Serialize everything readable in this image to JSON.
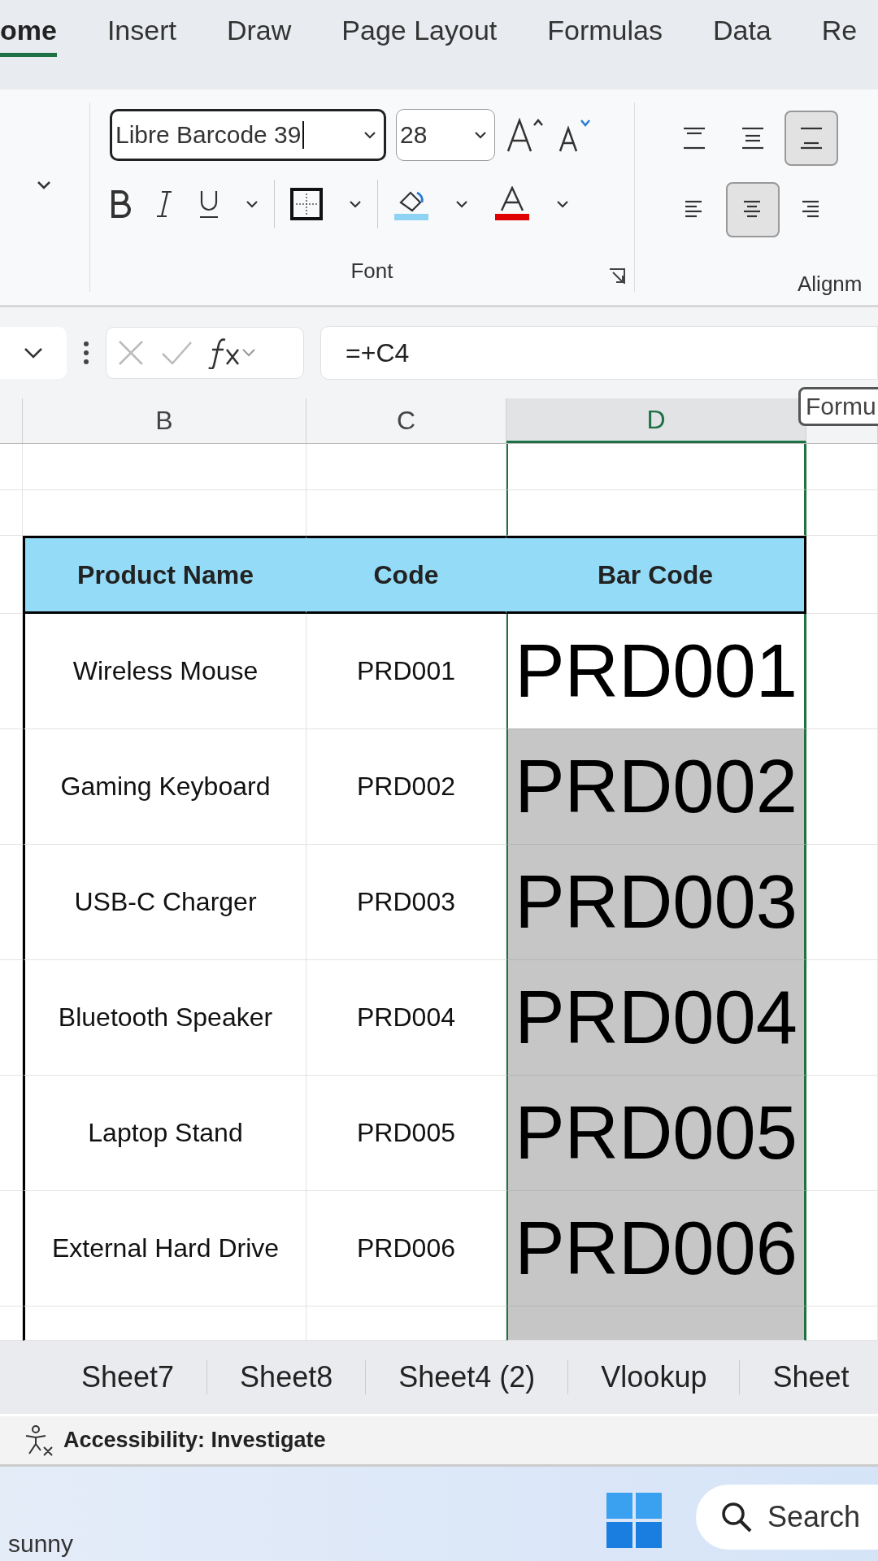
{
  "ribbon_tabs": [
    {
      "label": "ome",
      "selected": true
    },
    {
      "label": "Insert",
      "selected": false
    },
    {
      "label": "Draw",
      "selected": false
    },
    {
      "label": "Page Layout",
      "selected": false
    },
    {
      "label": "Formulas",
      "selected": false
    },
    {
      "label": "Data",
      "selected": false
    },
    {
      "label": "Re",
      "selected": false
    }
  ],
  "font_group": {
    "font_name": "Libre Barcode 39",
    "font_size": "28",
    "label": "Font"
  },
  "alignment_group": {
    "label": "Alignm",
    "buttons": [
      {
        "kind": "top",
        "selected": false
      },
      {
        "kind": "middle",
        "selected": false
      },
      {
        "kind": "bottom",
        "selected": true
      },
      {
        "kind": "left",
        "selected": false
      },
      {
        "kind": "center",
        "selected": true
      },
      {
        "kind": "right",
        "selected": false
      }
    ]
  },
  "formula_bar": {
    "formula": "=+C4",
    "tooltip": "Formu"
  },
  "columns": [
    {
      "label": "B",
      "selected": false
    },
    {
      "label": "C",
      "selected": false
    },
    {
      "label": "D",
      "selected": true
    }
  ],
  "table": {
    "headers": [
      "Product Name",
      "Code",
      "Bar Code"
    ],
    "rows": [
      {
        "name": "Wireless Mouse",
        "code": "PRD001",
        "barcode": "PRD001",
        "highlighted": false
      },
      {
        "name": "Gaming Keyboard",
        "code": "PRD002",
        "barcode": "PRD002",
        "highlighted": true
      },
      {
        "name": "USB-C Charger",
        "code": "PRD003",
        "barcode": "PRD003",
        "highlighted": true
      },
      {
        "name": "Bluetooth Speaker",
        "code": "PRD004",
        "barcode": "PRD004",
        "highlighted": true
      },
      {
        "name": "Laptop Stand",
        "code": "PRD005",
        "barcode": "PRD005",
        "highlighted": true
      },
      {
        "name": "External Hard Drive",
        "code": "PRD006",
        "barcode": "PRD006",
        "highlighted": true
      }
    ]
  },
  "sheet_tabs": [
    "Sheet7",
    "Sheet8",
    "Sheet4 (2)",
    "Vlookup",
    "Sheet"
  ],
  "status_bar": {
    "accessibility": "Accessibility: Investigate"
  },
  "taskbar": {
    "weather": "sunny",
    "search": "Search"
  }
}
